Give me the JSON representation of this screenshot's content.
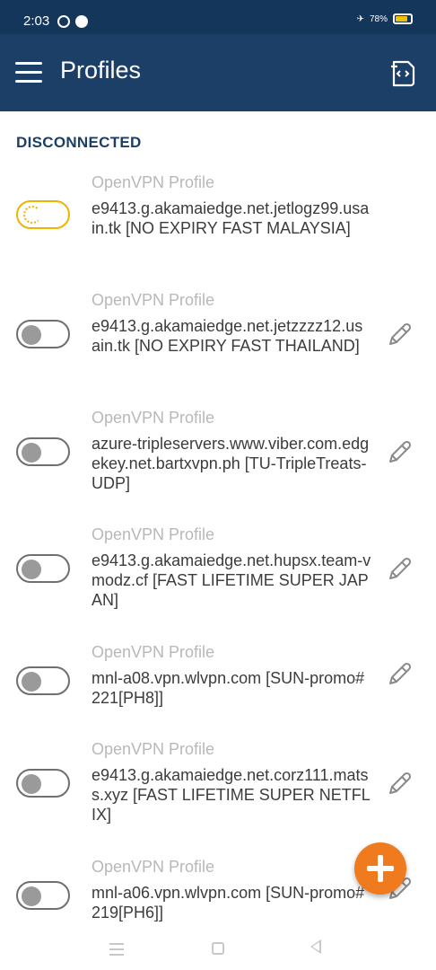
{
  "status_bar": {
    "time": "2:03",
    "battery": "78%"
  },
  "app_bar": {
    "title": "Profiles"
  },
  "section": {
    "label": "DISCONNECTED"
  },
  "profiles": [
    {
      "type": "OpenVPN Profile",
      "name": "e9413.g.akamaiedge.net.jetlogz99.usain.tk [NO EXPIRY FAST MALAYSIA]",
      "connecting": true,
      "editable": false
    },
    {
      "type": "OpenVPN Profile",
      "name": "e9413.g.akamaiedge.net.jetzzzz12.usain.tk [NO EXPIRY FAST THAILAND]",
      "connecting": false,
      "editable": true
    },
    {
      "type": "OpenVPN Profile",
      "name": "azure-tripleservers.www.viber.com.edgekey.net.bartxvpn.ph [TU-TripleTreats-UDP]",
      "connecting": false,
      "editable": true
    },
    {
      "type": "OpenVPN Profile",
      "name": "e9413.g.akamaiedge.net.hupsx.team-vmodz.cf [FAST LIFETIME SUPER JAPAN]",
      "connecting": false,
      "editable": true
    },
    {
      "type": "OpenVPN Profile",
      "name": "mnl-a08.vpn.wlvpn.com [SUN-promo#221[PH8]]",
      "connecting": false,
      "editable": true
    },
    {
      "type": "OpenVPN Profile",
      "name": "e9413.g.akamaiedge.net.corz111.matss.xyz [FAST LIFETIME SUPER NETFLIX]",
      "connecting": false,
      "editable": true
    },
    {
      "type": "OpenVPN Profile",
      "name": "mnl-a06.vpn.wlvpn.com [SUN-promo#219[PH6]]",
      "connecting": false,
      "editable": true
    }
  ],
  "icons": {
    "menu": "hamburger-menu-icon",
    "import": "import-file-icon",
    "edit": "pencil-icon",
    "add": "plus-icon"
  },
  "colors": {
    "status_bar": "#14365a",
    "app_bar": "#1c3f68",
    "accent": "#f07a1e",
    "focus": "#f0b400",
    "section_text": "#1c3f68"
  }
}
